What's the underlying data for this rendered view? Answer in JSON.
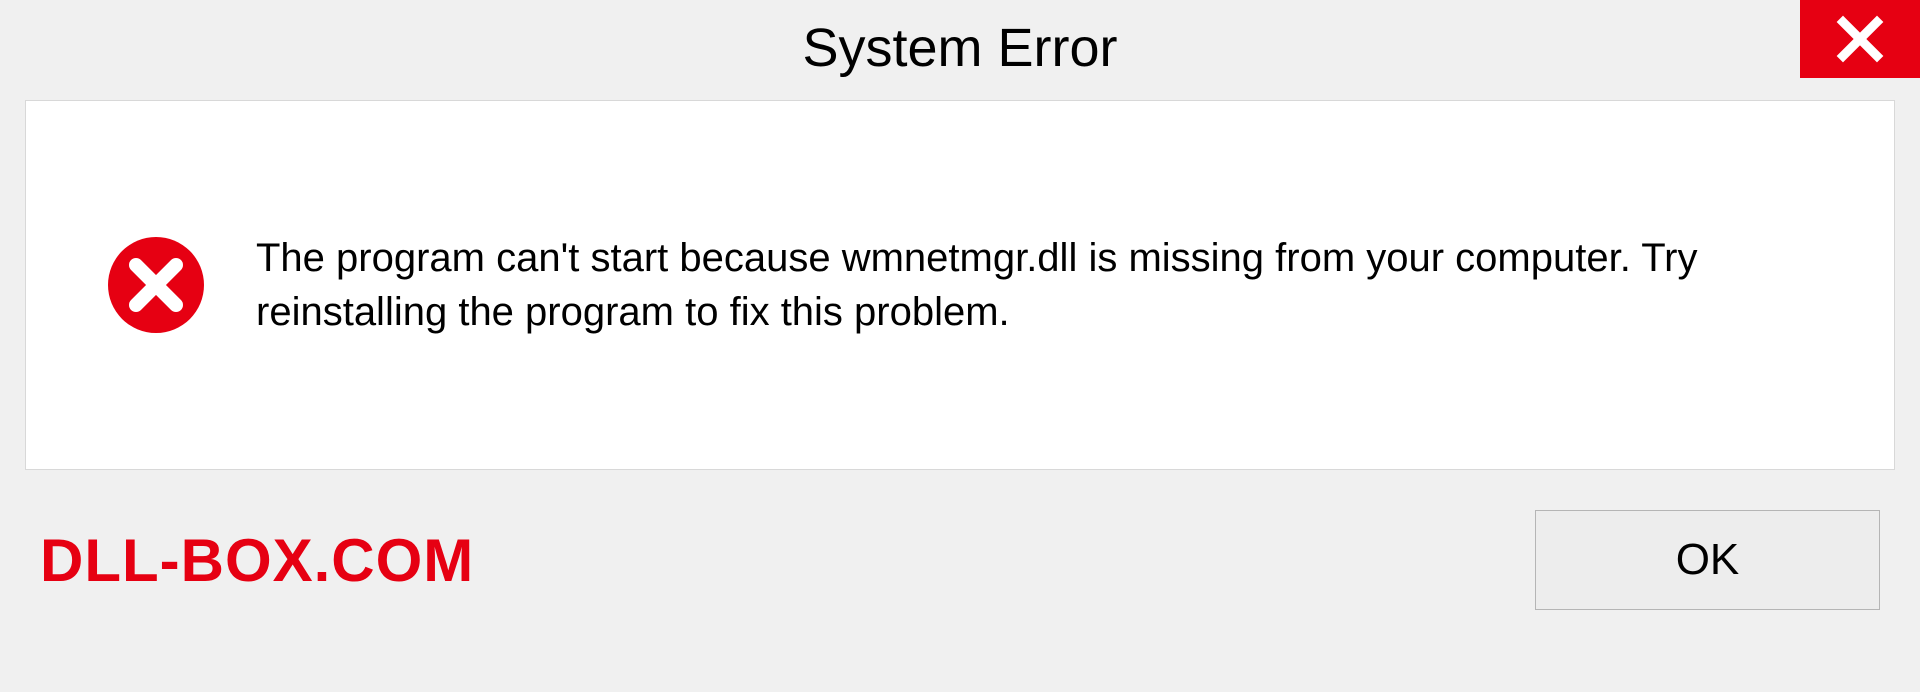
{
  "titlebar": {
    "title": "System Error"
  },
  "content": {
    "message": "The program can't start because wmnetmgr.dll is missing from your computer. Try reinstalling the program to fix this problem."
  },
  "footer": {
    "watermark": "DLL-BOX.COM",
    "ok_label": "OK"
  },
  "colors": {
    "close_bg": "#e60012",
    "error_icon": "#e60012",
    "watermark": "#e60012"
  }
}
